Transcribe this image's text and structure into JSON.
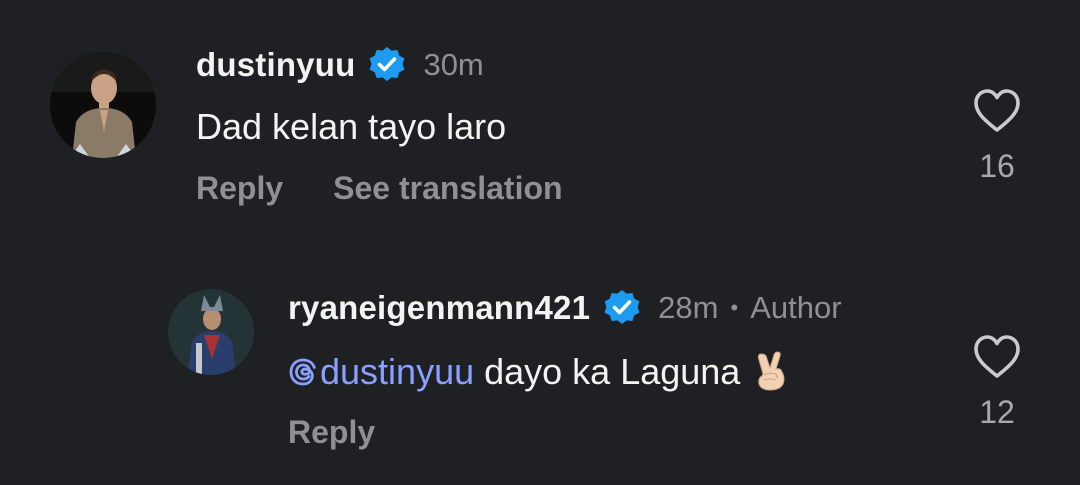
{
  "comments": [
    {
      "username": "dustinyuu",
      "time": "30m",
      "text": "Dad kelan tayo laro",
      "actions": [
        "Reply",
        "See translation"
      ],
      "likes": "16",
      "avatar_icon": "person-avatar"
    },
    {
      "username": "ryaneigenmann421",
      "time": "28m",
      "separator": "•",
      "badge": "Author",
      "mention": "dustinyuu",
      "text": " dayo ka Laguna",
      "emoji": "victory-hand-emoji",
      "actions": [
        "Reply"
      ],
      "likes": "12",
      "avatar_icon": "person-avatar"
    }
  ],
  "colors": {
    "background": "#1f2024",
    "verified": "#1d9bf0",
    "mention": "#8aa0ff",
    "muted": "#8e9096"
  }
}
